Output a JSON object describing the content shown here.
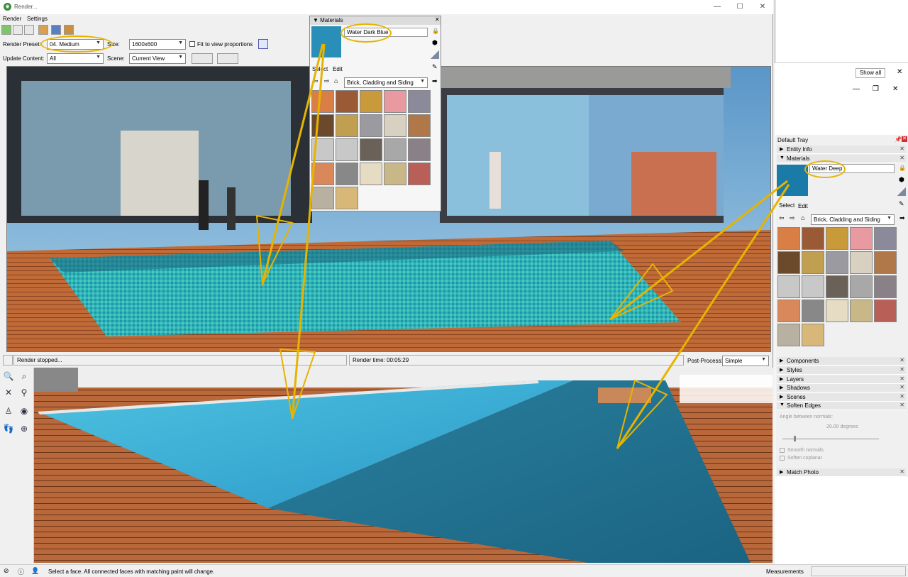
{
  "window": {
    "title": "Render...",
    "min": "—",
    "max": "☐",
    "close": "✕"
  },
  "menu": [
    "Render",
    "Settings"
  ],
  "toolbar1": {
    "render_preset_label": "Render Preset:",
    "render_preset_value": "04. Medium",
    "size_label": "Size:",
    "size_value": "1600x600",
    "fit_label": "Fit to view proportions"
  },
  "toolbar2": {
    "update_label": "Update Content:",
    "update_value": "All",
    "scene_label": "Scene:",
    "scene_value": "Current View"
  },
  "status": {
    "stopped": "Render stopped...",
    "render_time": "Render time: 00:05:29",
    "post_label": "Post-Process:",
    "post_value": "Simple"
  },
  "materials_popup": {
    "title": "Materials",
    "name": "Water Dark Blue",
    "tab_select": "Select",
    "tab_edit": "Edit",
    "library": "Brick, Cladding and Siding"
  },
  "tray": {
    "show_all": "Show all",
    "title": "Default Tray",
    "entity_info": "Entity Info",
    "materials": "Materials",
    "material_name": "Water Deep",
    "tab_select": "Select",
    "tab_edit": "Edit",
    "library": "Brick, Cladding and Siding",
    "sections": [
      "Components",
      "Styles",
      "Layers",
      "Shadows",
      "Scenes",
      "Soften Edges"
    ],
    "soften": {
      "angle_label": "Angle between normals:",
      "angle_value": "20.00  degrees",
      "smooth": "Smooth normals",
      "coplanar": "Soften coplanar"
    },
    "match_photo": "Match Photo"
  },
  "statusbar": {
    "hint": "Select a face.  All connected faces with matching paint will change.",
    "measurements": "Measurements"
  },
  "swatch_colors": [
    "#d97f45",
    "#9a5a35",
    "#c89a3a",
    "#e89aa0",
    "#8a8a9a",
    "#6a4a2a",
    "#c0a050",
    "#9a9aa0",
    "#d8d0c0",
    "#b07848",
    "#c8c8c8",
    "#c8c8c8",
    "#6a6258",
    "#a8a8a8",
    "#8a8088",
    "#d8885a",
    "#888888",
    "#e6dcc4",
    "#c8b888",
    "#b86058",
    "#b8b0a0",
    "#d8b878"
  ],
  "colors": {
    "highlight": "#e6b400",
    "water_light": "#3fb0d0",
    "water_dark": "#1f6f8a",
    "deck": "#b8683a"
  }
}
